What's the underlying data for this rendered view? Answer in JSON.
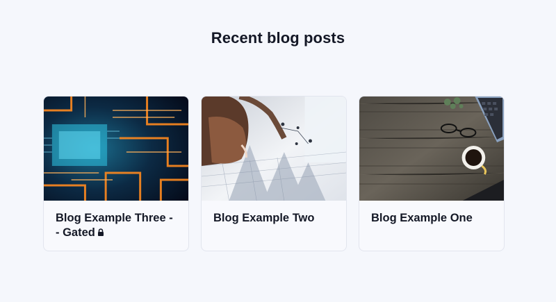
{
  "section": {
    "title": "Recent blog posts"
  },
  "posts": [
    {
      "title": "Blog Example Three -- Gated",
      "gated": true,
      "image": "circuit-board-image"
    },
    {
      "title": "Blog Example Two",
      "gated": false,
      "image": "analytics-chart-hands-image"
    },
    {
      "title": "Blog Example One",
      "gated": false,
      "image": "wooden-desk-workspace-image"
    }
  ],
  "icons": {
    "gated": "lock-icon"
  }
}
